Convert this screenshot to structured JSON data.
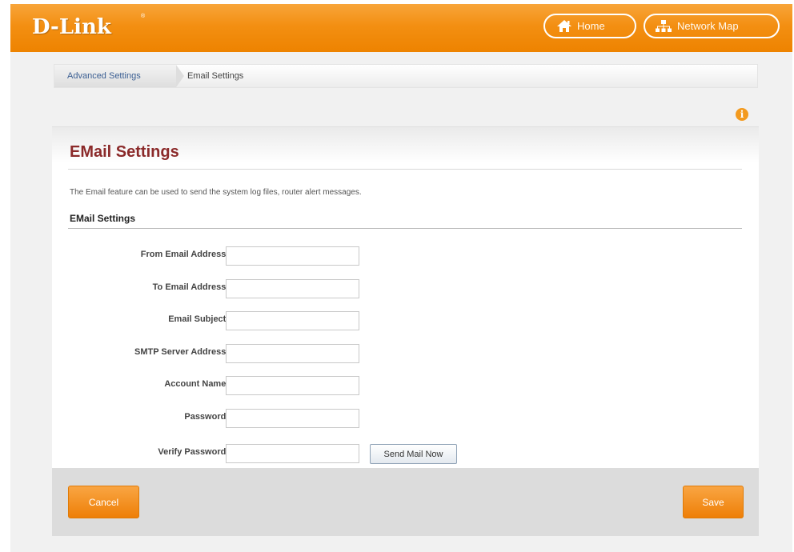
{
  "header": {
    "logo": "D-Link",
    "logo_mark": "®",
    "home_label": "Home",
    "network_map_label": "Network Map",
    "accent_color": "#f38f12"
  },
  "breadcrumb": {
    "parent": "Advanced Settings",
    "current": "Email Settings"
  },
  "info_icon": "info-icon",
  "panel": {
    "title": "EMail Settings",
    "description": "The Email feature can be used to send the system log files, router alert messages.",
    "section_title": "EMail Settings",
    "fields": [
      {
        "label": "From Email Address:",
        "value": ""
      },
      {
        "label": "To Email Address:",
        "value": ""
      },
      {
        "label": "Email Subject:",
        "value": ""
      },
      {
        "label": "SMTP Server Address:",
        "value": ""
      },
      {
        "label": "Account Name:",
        "value": ""
      },
      {
        "label": "Password:",
        "value": ""
      },
      {
        "label": "Verify Password:",
        "value": ""
      }
    ],
    "send_mail_label": "Send Mail Now"
  },
  "footer": {
    "cancel_label": "Cancel",
    "save_label": "Save"
  }
}
